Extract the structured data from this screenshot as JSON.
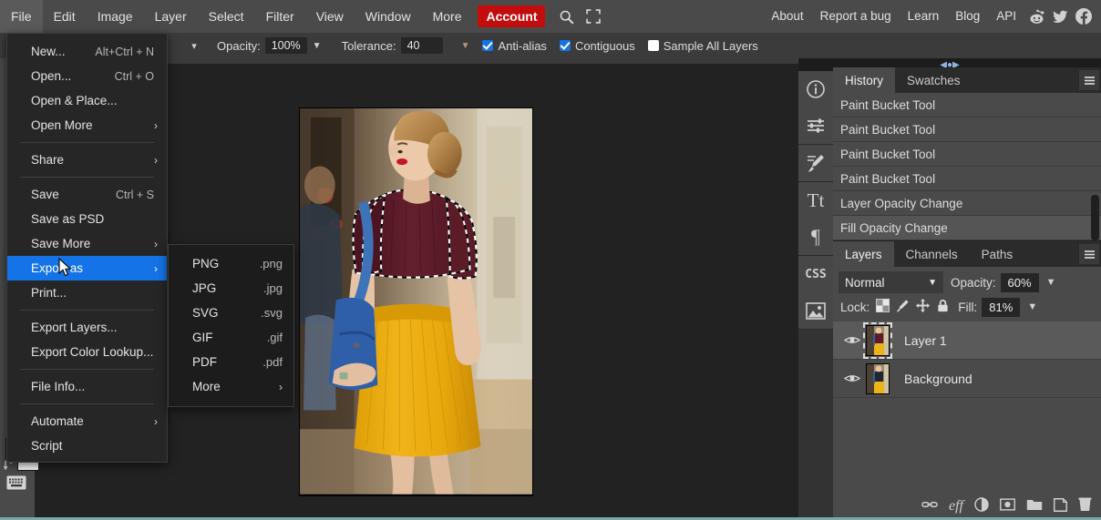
{
  "menubar": {
    "items": [
      "File",
      "Edit",
      "Image",
      "Layer",
      "Select",
      "Filter",
      "View",
      "Window",
      "More"
    ],
    "account_label": "Account",
    "search_icon": "search-icon",
    "fullscreen_icon": "fullscreen-icon",
    "right_links": [
      "About",
      "Report a bug",
      "Learn",
      "Blog",
      "API"
    ],
    "social": [
      "reddit-icon",
      "twitter-icon",
      "facebook-icon"
    ],
    "accent_color": "#c30d0d",
    "bar_color": "#4a4a4a"
  },
  "options_bar": {
    "opacity_label": "Opacity:",
    "opacity_value": "100%",
    "tolerance_label": "Tolerance:",
    "tolerance_value": "40",
    "antialias_label": "Anti-alias",
    "antialias_checked": "true",
    "contiguous_label": "Contiguous",
    "contiguous_checked": "true",
    "sample_label": "Sample All Layers",
    "sample_checked": "false",
    "check_color": "#1473e6"
  },
  "file_menu": {
    "rows": [
      {
        "label": "New...",
        "shortcut": "Alt+Ctrl + N",
        "arrow": "",
        "sep_after": false,
        "selected": false
      },
      {
        "label": "Open...",
        "shortcut": "Ctrl + O",
        "arrow": "",
        "sep_after": false,
        "selected": false
      },
      {
        "label": "Open & Place...",
        "shortcut": "",
        "arrow": "",
        "sep_after": false,
        "selected": false
      },
      {
        "label": "Open More",
        "shortcut": "",
        "arrow": "›",
        "sep_after": true,
        "selected": false
      },
      {
        "label": "Share",
        "shortcut": "",
        "arrow": "›",
        "sep_after": true,
        "selected": false
      },
      {
        "label": "Save",
        "shortcut": "Ctrl + S",
        "arrow": "",
        "sep_after": false,
        "selected": false
      },
      {
        "label": "Save as PSD",
        "shortcut": "",
        "arrow": "",
        "sep_after": false,
        "selected": false
      },
      {
        "label": "Save More",
        "shortcut": "",
        "arrow": "›",
        "sep_after": false,
        "selected": false
      },
      {
        "label": "Export as",
        "shortcut": "",
        "arrow": "›",
        "sep_after": false,
        "selected": true
      },
      {
        "label": "Print...",
        "shortcut": "",
        "arrow": "",
        "sep_after": true,
        "selected": false
      },
      {
        "label": "Export Layers...",
        "shortcut": "",
        "arrow": "",
        "sep_after": false,
        "selected": false
      },
      {
        "label": "Export Color Lookup...",
        "shortcut": "",
        "arrow": "",
        "sep_after": true,
        "selected": false
      },
      {
        "label": "File Info...",
        "shortcut": "",
        "arrow": "",
        "sep_after": true,
        "selected": false
      },
      {
        "label": "Automate",
        "shortcut": "",
        "arrow": "›",
        "sep_after": false,
        "selected": false
      },
      {
        "label": "Script",
        "shortcut": "",
        "arrow": "",
        "sep_after": false,
        "selected": false
      }
    ],
    "highlight_color": "#1473e6"
  },
  "export_submenu": {
    "rows": [
      {
        "label": "PNG",
        "ext": ".png",
        "arrow": ""
      },
      {
        "label": "JPG",
        "ext": ".jpg",
        "arrow": ""
      },
      {
        "label": "SVG",
        "ext": ".svg",
        "arrow": ""
      },
      {
        "label": "GIF",
        "ext": ".gif",
        "arrow": ""
      },
      {
        "label": "PDF",
        "ext": ".pdf",
        "arrow": ""
      },
      {
        "label": "More",
        "ext": "",
        "arrow": "›"
      }
    ]
  },
  "document": {
    "close_tab_label": "×"
  },
  "toolbox": {
    "foreground_color": "#8c1c1c",
    "background_color": "#ffffff",
    "swap_icon": "swap-colors-icon",
    "keyboard_icon": "keyboard-icon"
  },
  "panel_rail": {
    "icons": [
      "info-icon",
      "adjustments-icon",
      "brush-settings-icon",
      "type-icon",
      "paragraph-icon",
      "css-icon",
      "image-icon"
    ]
  },
  "history_panel": {
    "tabs": [
      {
        "label": "History",
        "active": true
      },
      {
        "label": "Swatches",
        "active": false
      }
    ],
    "menu_icon": "panel-menu-icon",
    "entries": [
      {
        "label": "Paint Bucket Tool",
        "highlighted": false
      },
      {
        "label": "Paint Bucket Tool",
        "highlighted": false
      },
      {
        "label": "Paint Bucket Tool",
        "highlighted": false
      },
      {
        "label": "Paint Bucket Tool",
        "highlighted": false
      },
      {
        "label": "Layer Opacity Change",
        "highlighted": false
      },
      {
        "label": "Fill Opacity Change",
        "highlighted": true
      }
    ]
  },
  "layers_panel": {
    "tabs": [
      {
        "label": "Layers",
        "active": true
      },
      {
        "label": "Channels",
        "active": false
      },
      {
        "label": "Paths",
        "active": false
      }
    ],
    "menu_icon": "panel-menu-icon",
    "blend_mode": "Normal",
    "opacity_label": "Opacity:",
    "opacity_value": "60%",
    "lock_label": "Lock:",
    "lock_icons": [
      "lock-transparency-icon",
      "lock-image-icon",
      "lock-position-icon",
      "lock-all-icon"
    ],
    "fill_label": "Fill:",
    "fill_value": "81%",
    "layers": [
      {
        "name": "Layer 1",
        "visible": true,
        "selected": true
      },
      {
        "name": "Background",
        "visible": true,
        "selected": false
      }
    ],
    "footer_icons": [
      "link-layers-icon",
      "layer-effects-icon",
      "adjustment-layer-icon",
      "layer-mask-icon",
      "new-group-icon",
      "new-layer-icon",
      "delete-layer-icon"
    ]
  }
}
